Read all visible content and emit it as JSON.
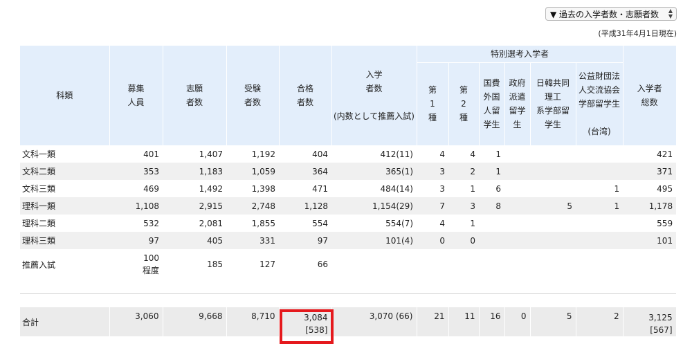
{
  "year_select": {
    "label": "▼ 過去の入学者数・志願者数"
  },
  "as_of": "(平成31年4月1日現在)",
  "headers": {
    "category": "科類",
    "quota": [
      "募集",
      "人員"
    ],
    "applicants": [
      "志願",
      "者数"
    ],
    "examinees": [
      "受験",
      "者数"
    ],
    "passed": [
      "合格",
      "者数"
    ],
    "enrolled": [
      "入学",
      "者数",
      "(内数として推薦入試)"
    ],
    "special_group": "特別選考入学者",
    "special1": [
      "第",
      "1",
      "種"
    ],
    "special2": [
      "第",
      "2",
      "種"
    ],
    "govt_foreign": [
      "国費",
      "外国",
      "人留",
      "学生"
    ],
    "govt_dispatch": [
      "政府",
      "派遣",
      "留学",
      "生"
    ],
    "japan_korea": [
      "日韓共同",
      "理工",
      "系学部留",
      "学生"
    ],
    "taiwan": [
      "公益財団法",
      "人交流協会",
      "学部留学生",
      "",
      "(台湾)"
    ],
    "total_enrolled": [
      "入学者",
      "総数"
    ]
  },
  "rows": [
    {
      "category": "文科一類",
      "quota": "401",
      "applicants": "1,407",
      "examinees": "1,192",
      "passed": "404",
      "enrolled": "412(11)",
      "s1": "4",
      "s2": "4",
      "gf": "1",
      "gd": "",
      "jk": "",
      "tw": "",
      "total": "421"
    },
    {
      "category": "文科二類",
      "quota": "353",
      "applicants": "1,183",
      "examinees": "1,059",
      "passed": "364",
      "enrolled": "365(1)",
      "s1": "3",
      "s2": "2",
      "gf": "1",
      "gd": "",
      "jk": "",
      "tw": "",
      "total": "371"
    },
    {
      "category": "文科三類",
      "quota": "469",
      "applicants": "1,492",
      "examinees": "1,398",
      "passed": "471",
      "enrolled": "484(14)",
      "s1": "3",
      "s2": "1",
      "gf": "6",
      "gd": "",
      "jk": "",
      "tw": "1",
      "total": "495"
    },
    {
      "category": "理科一類",
      "quota": "1,108",
      "applicants": "2,915",
      "examinees": "2,748",
      "passed": "1,128",
      "enrolled": "1,154(29)",
      "s1": "7",
      "s2": "3",
      "gf": "8",
      "gd": "",
      "jk": "5",
      "tw": "1",
      "total": "1,178"
    },
    {
      "category": "理科二類",
      "quota": "532",
      "applicants": "2,081",
      "examinees": "1,855",
      "passed": "554",
      "enrolled": "554(7)",
      "s1": "4",
      "s2": "1",
      "gf": "",
      "gd": "",
      "jk": "",
      "tw": "",
      "total": "559"
    },
    {
      "category": "理科三類",
      "quota": "97",
      "applicants": "405",
      "examinees": "331",
      "passed": "97",
      "enrolled": "101(4)",
      "s1": "0",
      "s2": "0",
      "gf": "",
      "gd": "",
      "jk": "",
      "tw": "",
      "total": "101"
    }
  ],
  "recommend": {
    "category": "推薦入試",
    "quota": [
      "100",
      "程度"
    ],
    "applicants": "185",
    "examinees": "127",
    "passed": "66"
  },
  "total": {
    "category": "合計",
    "quota": "3,060",
    "applicants": "9,668",
    "examinees": "8,710",
    "passed": [
      "3,084",
      "[538]"
    ],
    "enrolled": "3,070 (66)",
    "s1": "21",
    "s2": "11",
    "gf": "16",
    "gd": "0",
    "jk": "5",
    "tw": "2",
    "total": [
      "3,125",
      "[567]"
    ]
  },
  "highlight_color": "#e5191d",
  "header_bg": "#e3eefb"
}
